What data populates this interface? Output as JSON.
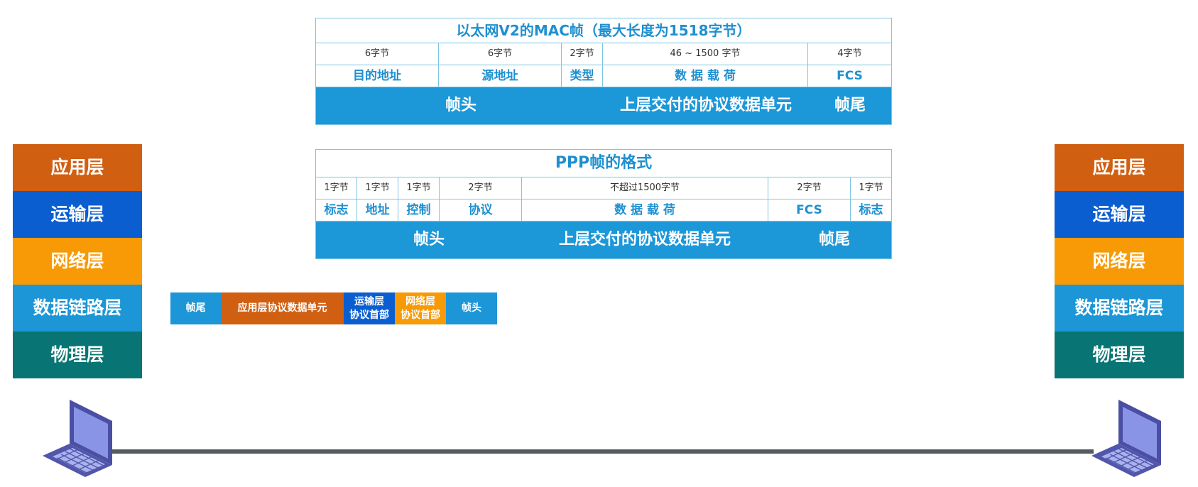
{
  "ethernet_frame": {
    "title": "以太网V2的MAC帧（最大长度为1518字节）",
    "fields": [
      {
        "bytes": "6字节",
        "name": "目的地址"
      },
      {
        "bytes": "6字节",
        "name": "源地址"
      },
      {
        "bytes": "2字节",
        "name": "类型"
      },
      {
        "bytes": "46 ~ 1500 字节",
        "name": "数 据 载 荷"
      },
      {
        "bytes": "4字节",
        "name": "FCS"
      }
    ],
    "bar": {
      "head": "帧头",
      "payload": "上层交付的协议数据单元",
      "tail": "帧尾"
    }
  },
  "ppp_frame": {
    "title": "PPP帧的格式",
    "fields": [
      {
        "bytes": "1字节",
        "name": "标志"
      },
      {
        "bytes": "1字节",
        "name": "地址"
      },
      {
        "bytes": "1字节",
        "name": "控制"
      },
      {
        "bytes": "2字节",
        "name": "协议"
      },
      {
        "bytes": "不超过1500字节",
        "name": "数 据 载 荷"
      },
      {
        "bytes": "2字节",
        "name": "FCS"
      },
      {
        "bytes": "1字节",
        "name": "标志"
      }
    ],
    "bar": {
      "head": "帧头",
      "payload": "上层交付的协议数据单元",
      "tail": "帧尾"
    }
  },
  "layers": [
    "应用层",
    "运输层",
    "网络层",
    "数据链路层",
    "物理层"
  ],
  "encapsulated_frame": {
    "tail": "帧尾",
    "app_pdu": "应用层协议数据单元",
    "transport_header": [
      "运输层",
      "协议首部"
    ],
    "network_header": [
      "网络层",
      "协议首部"
    ],
    "head": "帧头"
  },
  "colors": {
    "application": "#d15f12",
    "transport": "#0a5ed0",
    "network": "#f79a05",
    "data_link": "#1c96d6",
    "physical": "#087574",
    "accent": "#1e90d0"
  },
  "icons": [
    "laptop-icon",
    "laptop-icon"
  ]
}
